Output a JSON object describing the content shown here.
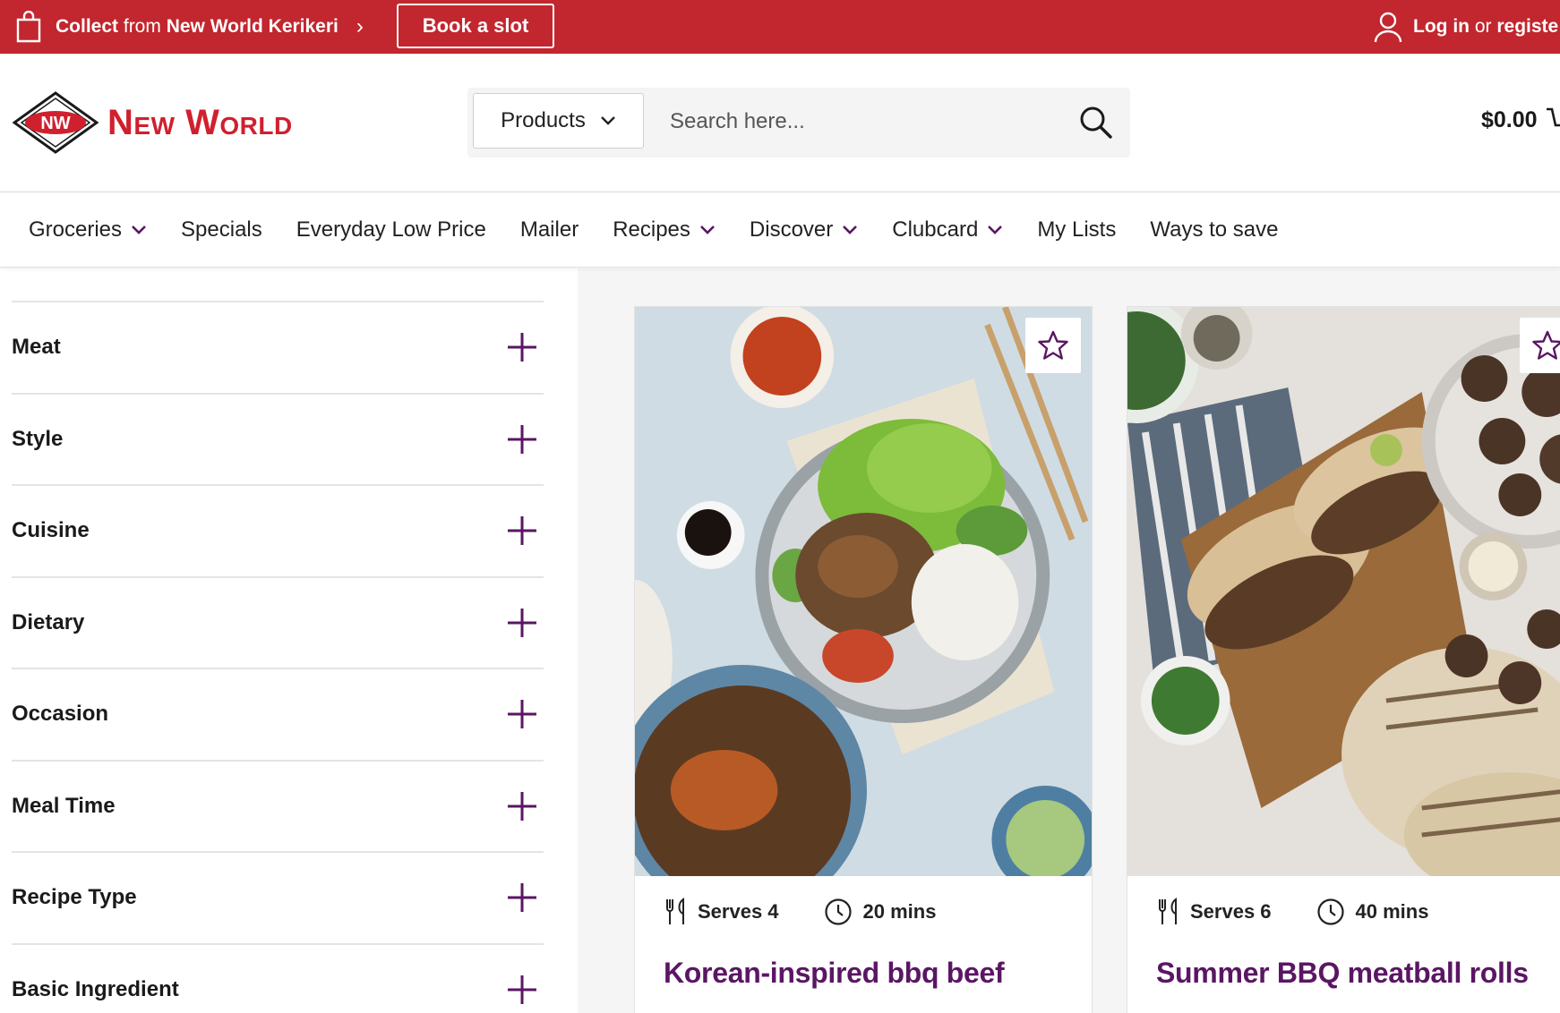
{
  "topbar": {
    "collect_prefix": "Collect",
    "collect_mid": "from",
    "store": "New World Kerikeri",
    "book_label": "Book a slot",
    "login_label": "Log in",
    "or": "or",
    "register_label": "registe"
  },
  "header": {
    "logo_badge": "NW",
    "logo_text": "New World",
    "search_category": "Products",
    "search_placeholder": "Search here...",
    "cart_total": "$0.00"
  },
  "nav": [
    {
      "label": "Groceries",
      "has_dropdown": true
    },
    {
      "label": "Specials",
      "has_dropdown": false
    },
    {
      "label": "Everyday Low Price",
      "has_dropdown": false
    },
    {
      "label": "Mailer",
      "has_dropdown": false
    },
    {
      "label": "Recipes",
      "has_dropdown": true
    },
    {
      "label": "Discover",
      "has_dropdown": true
    },
    {
      "label": "Clubcard",
      "has_dropdown": true
    },
    {
      "label": "My Lists",
      "has_dropdown": false
    },
    {
      "label": "Ways to save",
      "has_dropdown": false
    }
  ],
  "filters": [
    "Meat",
    "Style",
    "Cuisine",
    "Dietary",
    "Occasion",
    "Meal Time",
    "Recipe Type",
    "Basic Ingredient"
  ],
  "recipes": [
    {
      "serves": "Serves 4",
      "time": "20 mins",
      "title": "Korean-inspired bbq beef"
    },
    {
      "serves": "Serves 6",
      "time": "40 mins",
      "title": "Summer BBQ meatball rolls"
    }
  ],
  "colors": {
    "brand_red": "#c2262e",
    "accent_purple": "#5a1663",
    "logo_red": "#d0202e"
  }
}
